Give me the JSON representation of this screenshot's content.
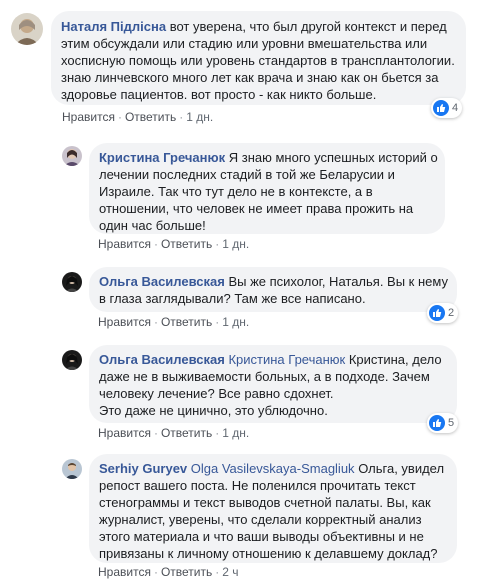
{
  "comments": [
    {
      "author": "Наталя Підлісна",
      "lines": [
        "вот уверена, что был другой контекст и перед",
        "этим обсуждали или стадию или уровни вмешательства или",
        "хосписную помощь или уровень стандартов в трансплантологии.",
        "знаю линчевского много лет как врача и знаю как он бьется за",
        "здоровье пациентов. вот просто - как никто больше."
      ],
      "like": "Нравится",
      "reply": "Ответить",
      "time": "1 дн.",
      "reactions": "4"
    },
    {
      "author": "Кристина Гречанюк",
      "lines": [
        "Я знаю много успешных историй о",
        "лечении последних стадий в той же Беларусии и",
        "Израиле. Так что тут дело не в контексте, а в",
        "отношении, что человек не имеет права прожить на",
        "один час больше!"
      ],
      "like": "Нравится",
      "reply": "Ответить",
      "time": "1 дн."
    },
    {
      "author": "Ольга Василевская",
      "lines": [
        "Вы же психолог, Наталья. Вы к нему",
        "в глаза заглядывали? Там же все написано."
      ],
      "like": "Нравится",
      "reply": "Ответить",
      "time": "1 дн.",
      "reactions": "2"
    },
    {
      "author": "Ольга Василевская",
      "mention": "Кристина Гречанюк",
      "lines": [
        "Кристина, дело",
        "даже не в выживаемости больных, а в подходе. Зачем",
        "человеку лечение? Все равно сдохнет.",
        "Это даже не цинично, это ублюдочно."
      ],
      "like": "Нравится",
      "reply": "Ответить",
      "time": "1 дн.",
      "reactions": "5"
    },
    {
      "author": "Serhiy Guryev",
      "mention": "Olga Vasilevskaya-Smagliuk",
      "lines": [
        "Ольга, увидел",
        "репост вашего поста. Не поленился прочитать текст",
        "стенограммы и текст выводов счетной палаты. Вы, как",
        "журналист, уверены, что сделали корректный анализ",
        "этого материала и что ваши выводы объективны и не",
        "привязаны к личному отношению к делавшему доклад?"
      ],
      "like": "Нравится",
      "reply": "Ответить",
      "time": "2 ч"
    }
  ],
  "colors": {
    "author": "#385898",
    "bubble": "#f2f3f5",
    "like_badge": "#1877f2"
  }
}
